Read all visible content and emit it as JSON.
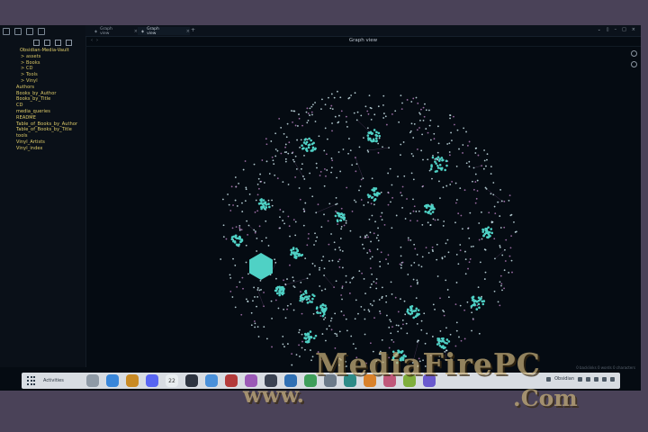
{
  "window": {
    "tabs": [
      {
        "label": "Graph view",
        "active": false
      },
      {
        "label": "Graph view",
        "active": true
      }
    ],
    "view_title": "Graph view"
  },
  "sidebar": {
    "tree": [
      {
        "label": "Obsidian-Media-Vault",
        "level": 1
      },
      {
        "label": "> assets",
        "level": 2
      },
      {
        "label": "> Books",
        "level": 2
      },
      {
        "label": "> CD",
        "level": 2
      },
      {
        "label": "> Tools",
        "level": 2
      },
      {
        "label": "> Vinyl",
        "level": 2
      },
      {
        "label": "Authors",
        "level": 0
      },
      {
        "label": "Books_by_Author",
        "level": 0
      },
      {
        "label": "Books_by_Title",
        "level": 0
      },
      {
        "label": "CD",
        "level": 0
      },
      {
        "label": "media_queries",
        "level": 0
      },
      {
        "label": "README",
        "level": 0
      },
      {
        "label": "Table_of_Books_by_Author",
        "level": 0
      },
      {
        "label": "Table_of_Books_by_Title",
        "level": 0
      },
      {
        "label": "tools",
        "level": 0
      },
      {
        "label": "Vinyl_Artists",
        "level": 0
      },
      {
        "label": "Vinyl_index",
        "level": 0
      }
    ]
  },
  "status": {
    "text": "0 backlinks  0 words  0 characters"
  },
  "dock": {
    "activities": "Activities",
    "apps": [
      {
        "name": "settings",
        "color": "#8f9aa6"
      },
      {
        "name": "finder",
        "color": "#3a86d9"
      },
      {
        "name": "gimp",
        "color": "#c98a24"
      },
      {
        "name": "discord",
        "color": "#5865f2"
      },
      {
        "name": "calendar",
        "color": "#e8ecef"
      },
      {
        "name": "terminal",
        "color": "#2e3440"
      },
      {
        "name": "chrome",
        "color": "#4a90d9"
      },
      {
        "name": "app-red",
        "color": "#b33a3a"
      },
      {
        "name": "app-purple",
        "color": "#9b59b6"
      },
      {
        "name": "app-dark",
        "color": "#3b4252"
      },
      {
        "name": "app-blue",
        "color": "#2f6fb3"
      },
      {
        "name": "app-green",
        "color": "#3f9e5a"
      },
      {
        "name": "app-grey",
        "color": "#6c7a89"
      },
      {
        "name": "app-teal",
        "color": "#2e8b87"
      },
      {
        "name": "app-orange",
        "color": "#d9822b"
      },
      {
        "name": "app-pink",
        "color": "#c0587a"
      },
      {
        "name": "app-lime",
        "color": "#7fae3c"
      },
      {
        "name": "app-violet",
        "color": "#6a5acd"
      }
    ],
    "tray_app": "Obsidian",
    "calendar_day": "22"
  },
  "colors": {
    "node": "#4fd1c5",
    "node_dim": "#2f6f73",
    "edge": "#6b4a78"
  },
  "watermark": {
    "line1": "MediaFirePC",
    "line2": "www.",
    "line3": ".Com"
  }
}
